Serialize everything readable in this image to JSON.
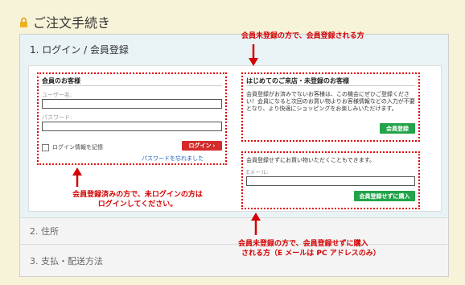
{
  "header": {
    "title": "ご注文手続き",
    "lock_icon": "lock-icon"
  },
  "steps": {
    "step1": "1. ログイン / 会員登録",
    "step2": "2. 住所",
    "step3": "3. 支払・配送方法"
  },
  "member": {
    "heading": "会員のお客様",
    "username_label": "ユーザー名:",
    "password_label": "パスワード:",
    "remember_label": "ログイン情報を記憶",
    "login_button": "ログイン",
    "forgot_link": "パスワードを忘れました"
  },
  "new_customer": {
    "heading": "はじめてのご来店・未登録のお客様",
    "description": "会員登録がお済みでないお客様は、この機会にぜひご登録ください！会員になると次回のお買い物よりお客様情報などの入力が不要となり、より快適にショッピングをお楽しみいただけます。",
    "register_button": "会員登録"
  },
  "guest": {
    "description": "会員登録せずにお買い物いただくこともできます。",
    "email_label": "Eメール:",
    "guest_button": "会員登録せずに購入"
  },
  "annotations": {
    "top": "会員未登録の方で、会員登録される方",
    "left_line1": "会員登録済みの方で、未ログインの方は",
    "left_line2": "ログインしてください。",
    "bottom_line1": "会員未登録の方で、会員登録せずに購入",
    "bottom_line2": "される方（E メールは PC アドレスのみ）"
  },
  "colors": {
    "annotation": "#d40000",
    "login_button": "#d42c2c",
    "green_button": "#23a34a",
    "background": "#f7f3d9"
  }
}
